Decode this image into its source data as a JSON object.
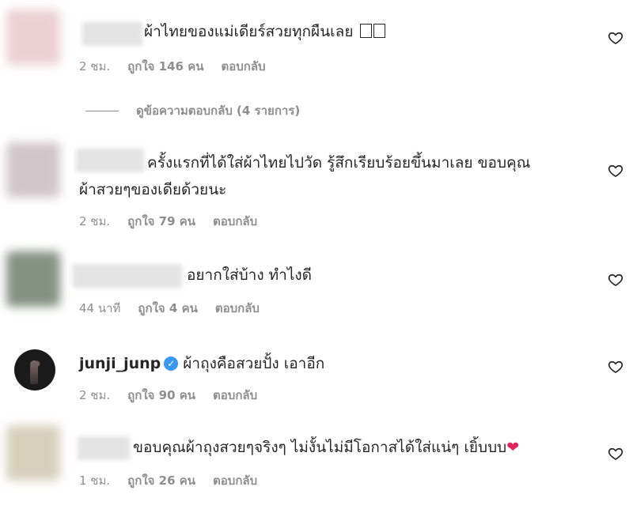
{
  "comments": [
    {
      "text": "ผ้าไทยของแม่เดียร์สวยทุกผืนเลย",
      "time": "2 ชม.",
      "likes": "ถูกใจ 146 คน",
      "reply": "ตอบกลับ",
      "view_replies": "ดูข้อความตอบกลับ (4 รายการ)",
      "avatar_color": "#e8c8cc"
    },
    {
      "text_line1": "ครั้งแรกที่ได้ใส่ผ้าไทยไปวัด รู้สึกเรียบร้อยขึ้นมาเลย ขอบคุณ",
      "text_line2": "ผ้าสวยๆของเดียด้วยนะ",
      "time": "2 ชม.",
      "likes": "ถูกใจ 79 คน",
      "reply": "ตอบกลับ",
      "avatar_color": "#c9bcc0"
    },
    {
      "text": "อยากใส่บ้าง ทำไงดี",
      "time": "44 นาที",
      "likes": "ถูกใจ 4 คน",
      "reply": "ตอบกลับ",
      "avatar_color": "#8a9a88"
    },
    {
      "username": "junji_junp",
      "text": "ผ้าถุงคือสวยปั้ง เอาอีก",
      "time": "2 ชม.",
      "likes": "ถูกใจ 90 คน",
      "reply": "ตอบกลับ"
    },
    {
      "text": "ขอบคุณผ้าถุงสวยๆจริงๆ ไม่งั้นไม่มีโอกาสได้ใส่แน่ๆ เยิ้บบบ",
      "time": "1 ชม.",
      "likes": "ถูกใจ 26 คน",
      "reply": "ตอบกลับ",
      "avatar_color": "#cfc8b0"
    }
  ],
  "icons": {
    "like": "heart-outline-icon",
    "verified": "verified-badge-icon",
    "emoji_heart": "red-heart-emoji"
  }
}
